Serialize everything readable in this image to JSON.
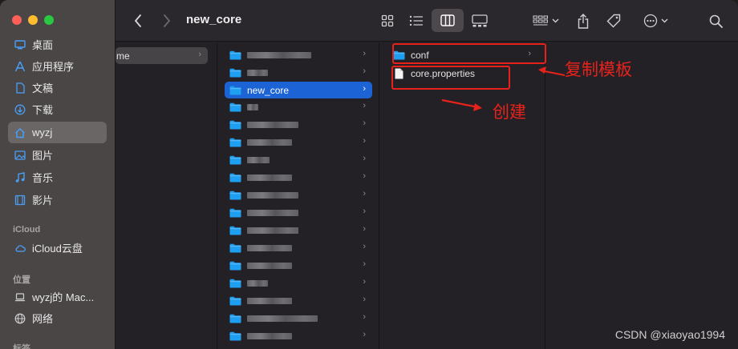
{
  "window": {
    "title": "new_core"
  },
  "sidebar": {
    "favorites": [
      {
        "label": "桌面",
        "icon": "desktop-icon"
      },
      {
        "label": "应用程序",
        "icon": "applications-icon"
      },
      {
        "label": "文稿",
        "icon": "document-icon"
      },
      {
        "label": "下载",
        "icon": "download-icon"
      },
      {
        "label": "wyzj",
        "icon": "home-icon",
        "active": true
      },
      {
        "label": "图片",
        "icon": "photos-icon"
      },
      {
        "label": "音乐",
        "icon": "music-icon"
      },
      {
        "label": "影片",
        "icon": "movies-icon"
      }
    ],
    "icloud_header": "iCloud",
    "icloud_items": [
      {
        "label": "iCloud云盘",
        "icon": "cloud-icon"
      }
    ],
    "locations_header": "位置",
    "locations_items": [
      {
        "label": "wyzj的 Mac...",
        "icon": "laptop-icon"
      },
      {
        "label": "网络",
        "icon": "network-icon"
      }
    ],
    "tags_header": "标签"
  },
  "columns": {
    "col1": {
      "selected_label": "me"
    },
    "col2": {
      "selected_label": "new_core"
    },
    "col3": {
      "items": [
        {
          "label": "conf",
          "type": "folder"
        },
        {
          "label": "core.properties",
          "type": "file"
        }
      ]
    }
  },
  "annotations": {
    "copy_template": "复制模板",
    "create": "创建"
  },
  "watermark": "CSDN @xiaoyao1994",
  "colors": {
    "accent": "#1c63d6",
    "annotation": "#e8221b",
    "folder": "#1e9ff2"
  }
}
